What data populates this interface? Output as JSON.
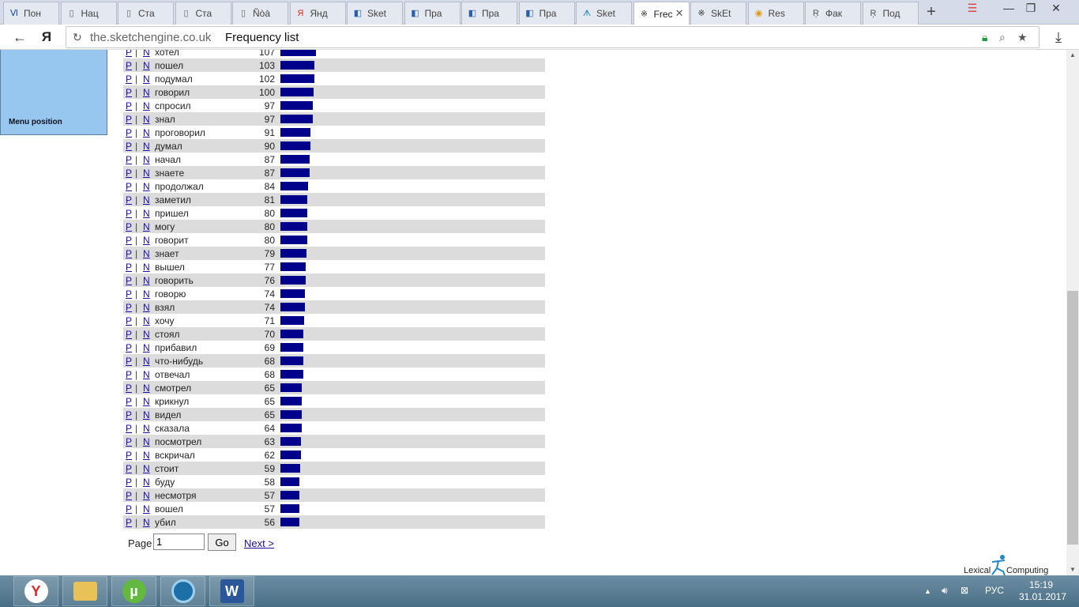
{
  "browser": {
    "tabs": [
      {
        "label": "Пон",
        "icon": "Ⅵ",
        "color": "#1a4f9c"
      },
      {
        "label": "Нац",
        "icon": "▯",
        "color": "#666"
      },
      {
        "label": "Ста",
        "icon": "▯",
        "color": "#666"
      },
      {
        "label": "Ста",
        "icon": "▯",
        "color": "#666"
      },
      {
        "label": "Ñòà",
        "icon": "▯",
        "color": "#666"
      },
      {
        "label": "Янд",
        "icon": "Я",
        "color": "#e52620"
      },
      {
        "label": "Sket",
        "icon": "◧",
        "color": "#2a5ea8"
      },
      {
        "label": "Пра",
        "icon": "◧",
        "color": "#2a5ea8"
      },
      {
        "label": "Пра",
        "icon": "◧",
        "color": "#2a5ea8"
      },
      {
        "label": "Пра",
        "icon": "◧",
        "color": "#2a5ea8"
      },
      {
        "label": "Sket",
        "icon": "ᗑ",
        "color": "#1f88c8"
      },
      {
        "label": "Frec",
        "icon": "※",
        "color": "#333",
        "active": true
      },
      {
        "label": "SkEt",
        "icon": "※",
        "color": "#333"
      },
      {
        "label": "Res",
        "icon": "◉",
        "color": "#e09b1a"
      },
      {
        "label": "Фак",
        "icon": "Ŗ",
        "color": "#555"
      },
      {
        "label": "Под",
        "icon": "Ŗ",
        "color": "#555"
      }
    ],
    "address_host": "the.sketchengine.co.uk",
    "address_title": "Frequency list"
  },
  "sidebar": {
    "menu_position_label": "Menu position"
  },
  "freq": {
    "p_label": "P",
    "n_label": "N",
    "separator": "|",
    "max_value": 107,
    "rows": [
      {
        "word": "хотел",
        "count": 107
      },
      {
        "word": "пошел",
        "count": 103
      },
      {
        "word": "подумал",
        "count": 102
      },
      {
        "word": "говорил",
        "count": 100
      },
      {
        "word": "спросил",
        "count": 97
      },
      {
        "word": "знал",
        "count": 97
      },
      {
        "word": "проговорил",
        "count": 91
      },
      {
        "word": "думал",
        "count": 90
      },
      {
        "word": "начал",
        "count": 87
      },
      {
        "word": "знаете",
        "count": 87
      },
      {
        "word": "продолжал",
        "count": 84
      },
      {
        "word": "заметил",
        "count": 81
      },
      {
        "word": "пришел",
        "count": 80
      },
      {
        "word": "могу",
        "count": 80
      },
      {
        "word": "говорит",
        "count": 80
      },
      {
        "word": "знает",
        "count": 79
      },
      {
        "word": "вышел",
        "count": 77
      },
      {
        "word": "говорить",
        "count": 76
      },
      {
        "word": "говорю",
        "count": 74
      },
      {
        "word": "взял",
        "count": 74
      },
      {
        "word": "хочу",
        "count": 71
      },
      {
        "word": "стоял",
        "count": 70
      },
      {
        "word": "прибавил",
        "count": 69
      },
      {
        "word": "что-нибудь",
        "count": 68
      },
      {
        "word": "отвечал",
        "count": 68
      },
      {
        "word": "смотрел",
        "count": 65
      },
      {
        "word": "крикнул",
        "count": 65
      },
      {
        "word": "видел",
        "count": 65
      },
      {
        "word": "сказала",
        "count": 64
      },
      {
        "word": "посмотрел",
        "count": 63
      },
      {
        "word": "вскричал",
        "count": 62
      },
      {
        "word": "стоит",
        "count": 59
      },
      {
        "word": "буду",
        "count": 58
      },
      {
        "word": "несмотря",
        "count": 57
      },
      {
        "word": "вошел",
        "count": 57
      },
      {
        "word": "убил",
        "count": 56
      }
    ]
  },
  "pager": {
    "label": "Page",
    "value": "1",
    "go_label": "Go",
    "next_label": "Next >"
  },
  "footer": {
    "logo_left": "Lexical",
    "logo_right": "Computing"
  },
  "taskbar": {
    "language": "РУС",
    "time": "15:19",
    "date": "31.01.2017"
  }
}
